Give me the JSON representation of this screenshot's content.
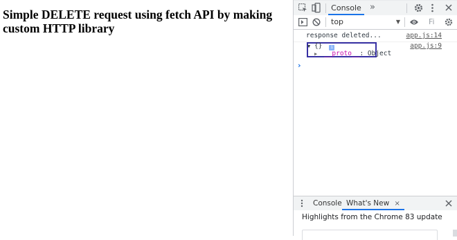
{
  "page": {
    "heading": "Simple DELETE request using fetch API by making custom HTTP library"
  },
  "devtools": {
    "toolbar": {
      "tab_console": "Console",
      "more_tabs": "»",
      "icons": [
        "inspect-element-icon",
        "device-toolbar-icon",
        "settings-gear-icon",
        "kebab-menu-icon",
        "close-icon"
      ]
    },
    "filterbar": {
      "context": "top",
      "filter_placeholder": "Fi",
      "icons": [
        "sidebar-toggle-icon",
        "clear-console-icon",
        "eye-icon",
        "console-settings-icon"
      ]
    },
    "console": {
      "messages": [
        {
          "text": "response deleted...",
          "source": "app.js:14"
        },
        {
          "text": "{}",
          "source": "app.js:9",
          "expanded_child_key": "__proto__",
          "expanded_child_value": "Object"
        }
      ],
      "prompt": "›"
    },
    "drawer": {
      "tabs": [
        {
          "label": "Console"
        },
        {
          "label": "What's New",
          "close": "×"
        }
      ],
      "close": "×",
      "highlights": "Highlights from the Chrome 83 update"
    },
    "colors": {
      "accent": "#1a73e8",
      "highlight_box": "#3730a3",
      "proto_key": "#c80dad"
    }
  }
}
